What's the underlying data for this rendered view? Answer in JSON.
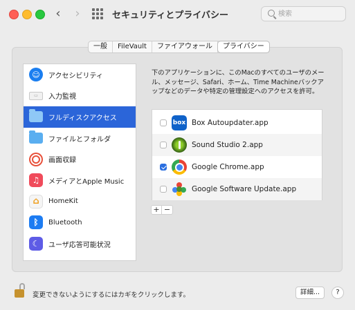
{
  "window": {
    "title": "セキュリティとプライバシー",
    "search_placeholder": "検索"
  },
  "tabs": [
    {
      "label": "一般",
      "active": false
    },
    {
      "label": "FileVault",
      "active": false
    },
    {
      "label": "ファイアウォール",
      "active": false
    },
    {
      "label": "プライバシー",
      "active": true
    }
  ],
  "sidebar": {
    "items": [
      {
        "label": "アクセシビリティ",
        "icon": "accessibility-icon"
      },
      {
        "label": "入力監視",
        "icon": "keyboard-icon"
      },
      {
        "label": "フルディスクアクセス",
        "icon": "folder-icon",
        "selected": true
      },
      {
        "label": "ファイルとフォルダ",
        "icon": "folder-icon"
      },
      {
        "label": "画面収録",
        "icon": "screen-recording-icon"
      },
      {
        "label": "メディアとApple Music",
        "icon": "music-icon"
      },
      {
        "label": "HomeKit",
        "icon": "home-icon"
      },
      {
        "label": "Bluetooth",
        "icon": "bluetooth-icon"
      },
      {
        "label": "ユーザ応答可能状況",
        "icon": "focus-moon-icon"
      }
    ]
  },
  "main": {
    "description": "下のアプリケーションに、このMacのすべてのユーザのメール、メッセージ、Safari、ホーム、Time Machineバックアップなどのデータや特定の管理設定へのアクセスを許可。",
    "apps": [
      {
        "name": "Box Autoupdater.app",
        "checked": false,
        "icon": "box-app-icon",
        "icon_text": "box"
      },
      {
        "name": "Sound Studio 2.app",
        "checked": false,
        "icon": "sound-studio-icon"
      },
      {
        "name": "Google Chrome.app",
        "checked": true,
        "icon": "chrome-icon"
      },
      {
        "name": "Google Software Update.app",
        "checked": false,
        "icon": "google-software-update-icon"
      }
    ],
    "add_label": "+",
    "remove_label": "−"
  },
  "footer": {
    "lock_text": "変更できないようにするにはカギをクリックします。",
    "advanced_label": "詳細...",
    "help_label": "?"
  },
  "colors": {
    "selection": "#2b65d9",
    "checkbox_checked": "#2b6fe0"
  }
}
